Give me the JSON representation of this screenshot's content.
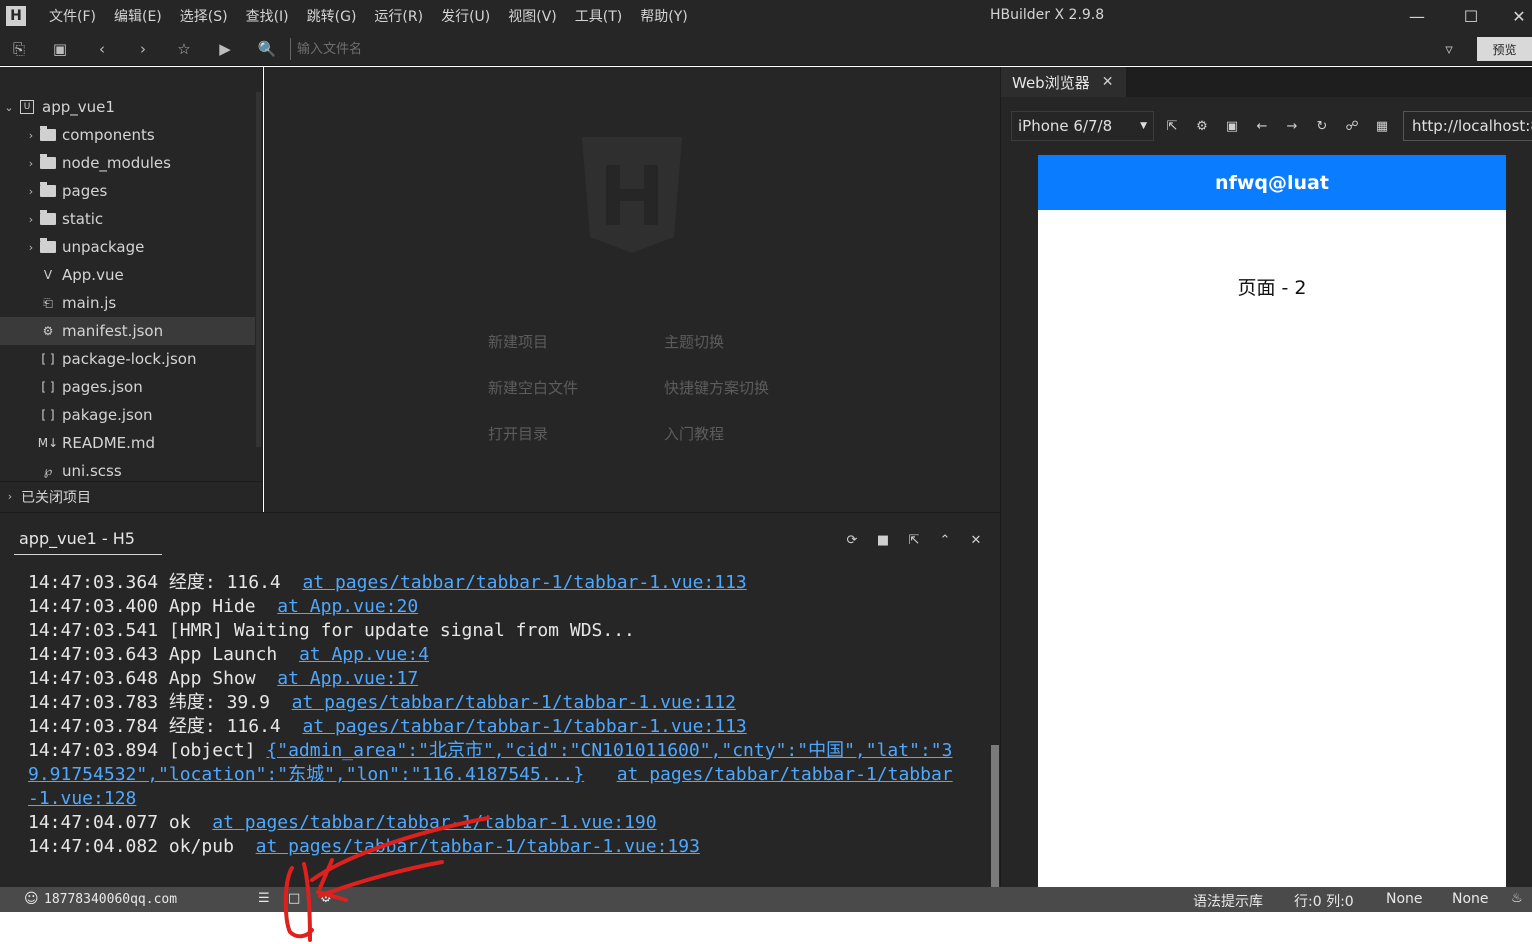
{
  "app": {
    "title": "HBuilder X 2.9.8",
    "logo_letter": "H",
    "menu": [
      "文件(F)",
      "编辑(E)",
      "选择(S)",
      "查找(I)",
      "跳转(G)",
      "运行(R)",
      "发行(U)",
      "视图(V)",
      "工具(T)",
      "帮助(Y)"
    ]
  },
  "toolbar": {
    "file_search_placeholder": "输入文件名",
    "preview_label": "预览"
  },
  "sidebar": {
    "project_name": "app_vue1",
    "items": [
      {
        "label": "components",
        "type": "folder"
      },
      {
        "label": "node_modules",
        "type": "folder"
      },
      {
        "label": "pages",
        "type": "folder"
      },
      {
        "label": "static",
        "type": "folder"
      },
      {
        "label": "unpackage",
        "type": "folder"
      },
      {
        "label": "App.vue",
        "type": "vue-file"
      },
      {
        "label": "main.js",
        "type": "js-file"
      },
      {
        "label": "manifest.json",
        "type": "settings-file",
        "selected": true
      },
      {
        "label": "package-lock.json",
        "type": "json-file"
      },
      {
        "label": "pages.json",
        "type": "json-file"
      },
      {
        "label": "pakage.json",
        "type": "json-file"
      },
      {
        "label": "README.md",
        "type": "markdown-file"
      },
      {
        "label": "uni.scss",
        "type": "scss-file"
      }
    ],
    "closed_projects_label": "已关闭项目"
  },
  "welcome": {
    "links": [
      "新建项目",
      "主题切换",
      "新建空白文件",
      "快捷键方案切换",
      "打开目录",
      "入门教程"
    ]
  },
  "console": {
    "tab_label": "app_vue1 - H5",
    "lines": [
      {
        "time": "14:47:03.364",
        "text": "经度: 116.4",
        "link": "at pages/tabbar/tabbar-1/tabbar-1.vue:113"
      },
      {
        "time": "14:47:03.400",
        "text": "App Hide",
        "link": "at App.vue:20"
      },
      {
        "time": "14:47:03.541",
        "text": "[HMR] Waiting for update signal from WDS...",
        "link": ""
      },
      {
        "time": "14:47:03.643",
        "text": "App Launch",
        "link": "at App.vue:4"
      },
      {
        "time": "14:47:03.648",
        "text": "App Show",
        "link": "at App.vue:17"
      },
      {
        "time": "14:47:03.783",
        "text": "纬度: 39.9",
        "link": "at pages/tabbar/tabbar-1/tabbar-1.vue:112"
      },
      {
        "time": "14:47:03.784",
        "text": "经度: 116.4",
        "link": "at pages/tabbar/tabbar-1/tabbar-1.vue:113"
      },
      {
        "time": "14:47:03.894",
        "text": "[object]",
        "json": "{\"admin_area\":\"北京市\",\"cid\":\"CN101011600\",\"cnty\":\"中国\",\"lat\":\"39.91754532\",\"location\":\"东城\",\"lon\":\"116.4187545...}",
        "link": "at pages/tabbar/tabbar-1/tabbar-1.vue:128"
      },
      {
        "time": "14:47:04.077",
        "text": "ok",
        "link": "at pages/tabbar/tabbar-1/tabbar-1.vue:190"
      },
      {
        "time": "14:47:04.082",
        "text": "ok/pub",
        "link": "at pages/tabbar/tabbar-1/tabbar-1.vue:193"
      }
    ],
    "wrapped": {
      "line8_a_prefix": "14:47:03.894 [object] ",
      "line8_a_link": "{\"admin_area\":\"北京市\",\"cid\":\"CN101011600\",\"cnty\":\"中国\",\"lat\":\"3",
      "line8_b_link1": "9.91754532\",\"location\":\"东城\",\"lon\":\"116.4187545...}",
      "line8_b_gap": "   ",
      "line8_b_link2": "at pages/tabbar/tabbar-1/tabbar",
      "line8_c_link": "-1.vue:128"
    }
  },
  "statusbar": {
    "account": "18778340060qq.com",
    "syntax_label": "语法提示库",
    "position": "行:0  列:0",
    "encoding": "None",
    "language": "None"
  },
  "browser": {
    "tab_label": "Web浏览器",
    "device": "iPhone 6/7/8",
    "url": "http://localhost:8",
    "page_title": "nfwq@luat",
    "page_text": "页面 - 2",
    "nav_color": "#0a7cff"
  },
  "annotation": {
    "color": "#e0201d"
  }
}
